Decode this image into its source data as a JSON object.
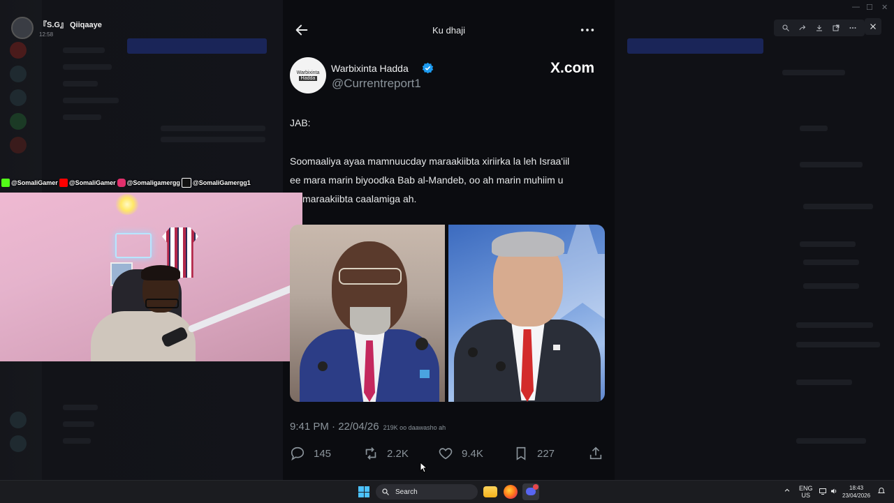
{
  "stream": {
    "user_name": "『S.G』 Qiiqaaye",
    "time": "12:58",
    "socials": [
      {
        "label": "@SomaliGamer",
        "icon": "kick-icon",
        "color": "#53fc18"
      },
      {
        "label": "@SomaliGamer",
        "icon": "youtube-icon",
        "color": "#ff0000"
      },
      {
        "label": "@Somaligamergg",
        "icon": "instagram-icon",
        "color": "#e1306c"
      },
      {
        "label": "@SomaliGamergg1",
        "icon": "tiktok-icon",
        "color": "#ffffff"
      }
    ]
  },
  "viewer": {
    "title": "Ku dhaji",
    "back_icon": "arrow-left-icon",
    "more_icon": "more-horizontal-icon",
    "tools": [
      "zoom-icon",
      "share-icon",
      "download-icon",
      "open-external-icon",
      "more-icon"
    ],
    "close_icon": "close-icon"
  },
  "tweet": {
    "avatar_line1": "Warbixinta",
    "avatar_line2": "Hadda",
    "author_name": "Warbixinta Hadda",
    "handle": "@Currentreport1",
    "site": "X.com",
    "verified_color": "#1d9bf0",
    "text_lines": [
      "JAB:",
      "Soomaaliya ayaa mamnuucday maraakiibta xiriirka la leh Israa'iil",
      "ee mara marin biyoodka Bab al-Mandeb, oo ah marin muhiim u",
      "maraakiibta caalamiga ah."
    ],
    "timestamp": "9:41 PM · 22/04/26",
    "views": "219K oo daawasho ah",
    "actions": {
      "replies": "145",
      "reposts": "2.2K",
      "likes": "9.4K",
      "bookmarks": "227"
    }
  },
  "taskbar": {
    "search_placeholder": "Search",
    "lang_line1": "ENG",
    "lang_line2": "US",
    "time": "18:43",
    "date": "23/04/2026",
    "accent": "#4cc2ff"
  }
}
